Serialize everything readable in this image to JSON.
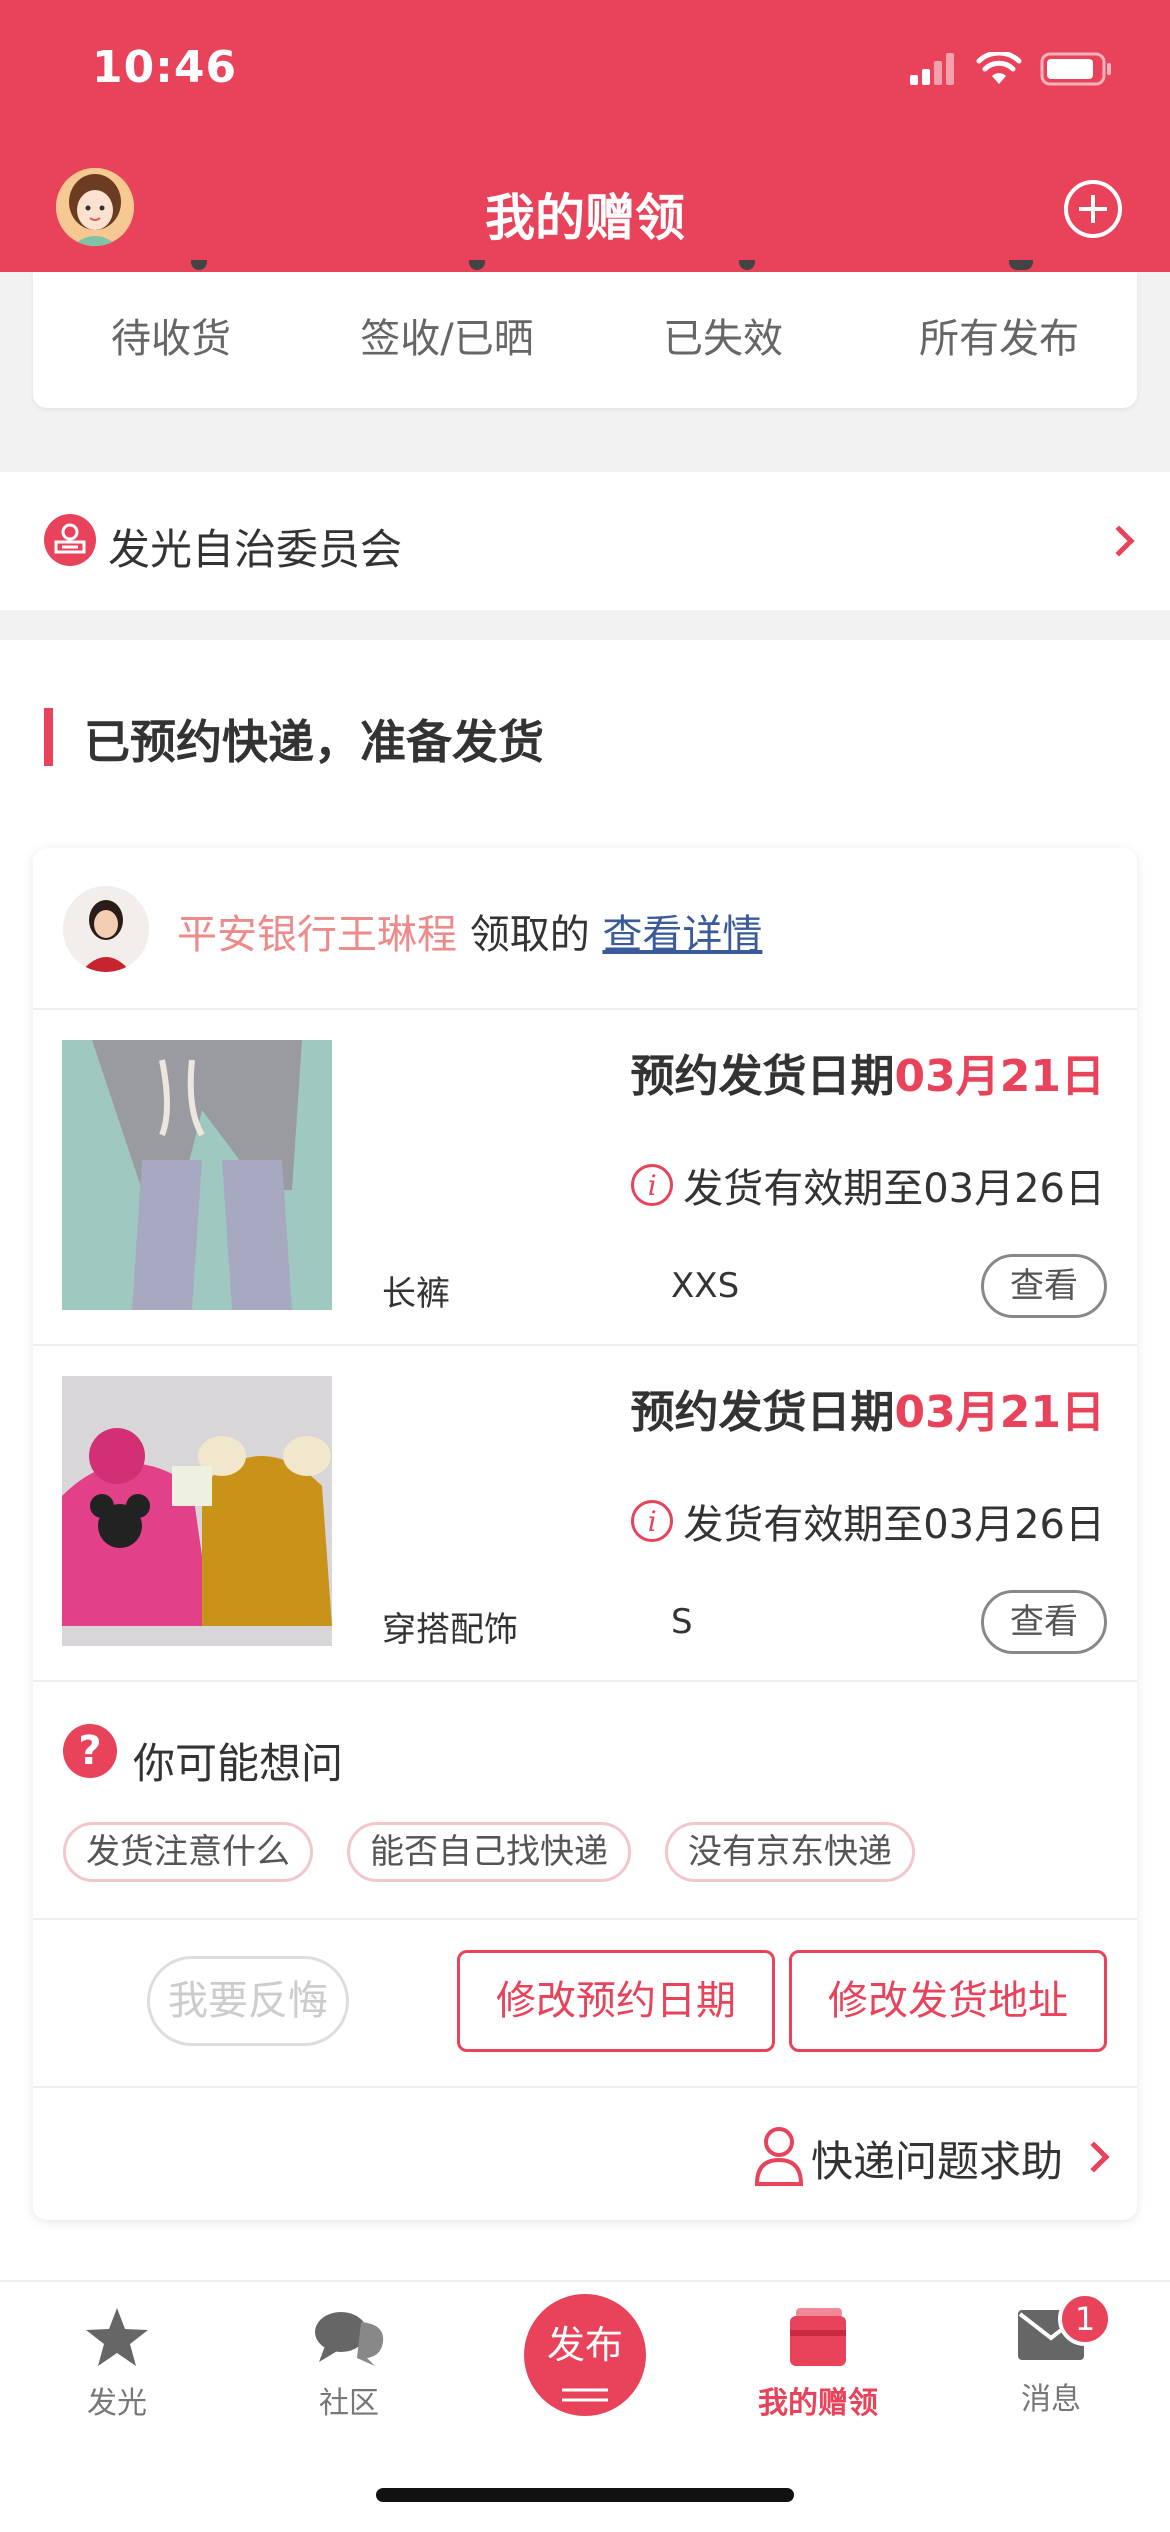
{
  "theme": {
    "accent": "#e8435a"
  },
  "status_bar": {
    "time": "10:46"
  },
  "nav": {
    "title": "我的赠领"
  },
  "stats_tabs": [
    "待收货",
    "签收/已晒",
    "已失效",
    "所有发布"
  ],
  "committee": {
    "label": "发光自治委员会"
  },
  "section": {
    "title": "已预约快递，准备发货"
  },
  "claim": {
    "name": "平安银行王琳程",
    "verb": "领取的",
    "detail_link": "查看详情"
  },
  "items": [
    {
      "date_label": "预约发货日期",
      "date_value": "03月21日",
      "valid_text": "发货有效期至03月26日",
      "category": "长裤",
      "size": "XXS",
      "view_label": "查看"
    },
    {
      "date_label": "预约发货日期",
      "date_value": "03月21日",
      "valid_text": "发货有效期至03月26日",
      "category": "穿搭配饰",
      "size": "S",
      "view_label": "查看"
    }
  ],
  "faq": {
    "title": "你可能想问",
    "tags": [
      "发货注意什么",
      "能否自己找快递",
      "没有京东快递"
    ]
  },
  "actions": {
    "regret": "我要反悔",
    "modify_date": "修改预约日期",
    "modify_address": "修改发货地址"
  },
  "help": {
    "label": "快递问题求助"
  },
  "tabbar": {
    "items": [
      {
        "label": "发光",
        "icon": "star-icon"
      },
      {
        "label": "社区",
        "icon": "chat-bubble-icon"
      },
      {
        "label": "发布",
        "icon": "publish-icon"
      },
      {
        "label": "我的赠领",
        "icon": "gift-box-icon"
      },
      {
        "label": "消息",
        "icon": "mail-icon"
      }
    ],
    "active_index": 3,
    "message_badge": "1"
  }
}
